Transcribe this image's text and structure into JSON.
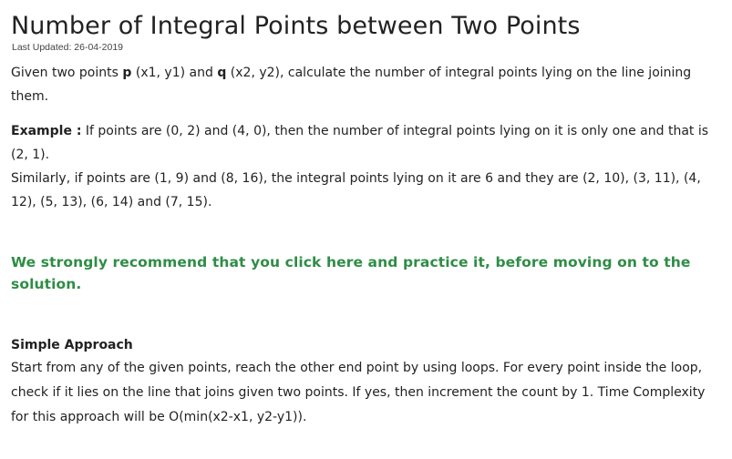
{
  "article": {
    "title": "Number of Integral Points between Two Points",
    "last_updated": "Last Updated: 26-04-2019",
    "intro": {
      "t1": "Given two points ",
      "p": "p",
      "t2": " (x1, y1) and ",
      "q": "q",
      "t3": " (x2, y2), calculate the number of integral points lying on the line joining them."
    },
    "example": {
      "label": "Example :",
      "text1": " If points are (0, 2) and (4, 0), then the number of integral points lying on it is only one and that is (2, 1).",
      "text2": "Similarly, if points are (1, 9) and (8, 16), the integral points lying on it are 6 and they are (2, 10), (3, 11), (4, 12), (5, 13), (6, 14) and (7, 15)."
    },
    "recommend": "We strongly recommend that you click here and practice it, before moving on to the solution.",
    "approach": {
      "heading": "Simple Approach",
      "text": "Start from any of the given points, reach the other end point by using loops. For every point inside the loop, check if it lies on the line that joins given two points. If yes, then increment the count by 1. Time Complexity for this approach will be O(min(x2-x1, y2-y1))."
    }
  }
}
